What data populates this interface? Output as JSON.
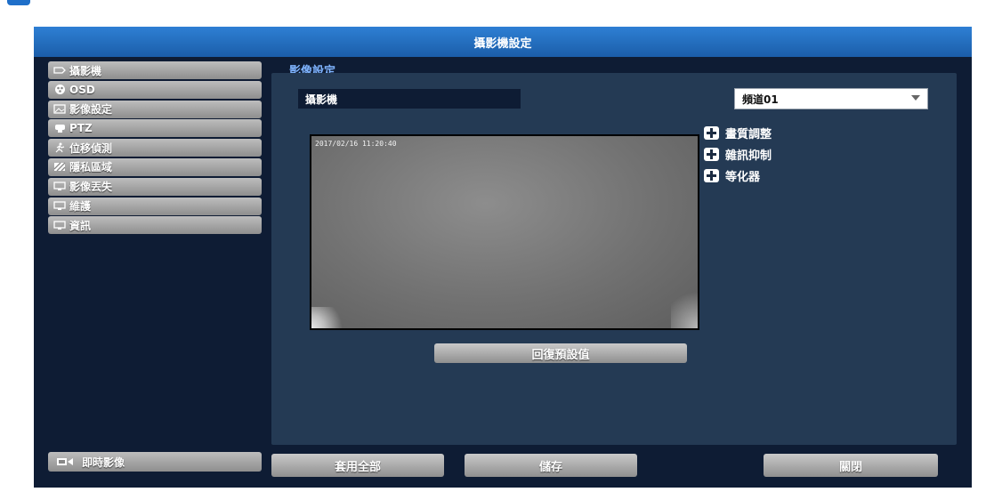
{
  "window": {
    "title": "攝影機設定"
  },
  "sidebar": {
    "items": [
      {
        "label": "攝影機",
        "icon": "camera-icon"
      },
      {
        "label": "OSD",
        "icon": "osd-icon"
      },
      {
        "label": "影像設定",
        "icon": "image-icon"
      },
      {
        "label": "PTZ",
        "icon": "ptz-icon"
      },
      {
        "label": "位移偵測",
        "icon": "motion-icon"
      },
      {
        "label": "隱私區域",
        "icon": "privacy-icon"
      },
      {
        "label": "影像丟失",
        "icon": "monitor-icon"
      },
      {
        "label": "維護",
        "icon": "monitor-icon"
      },
      {
        "label": "資訊",
        "icon": "monitor-icon"
      }
    ],
    "live_button": "即時影像"
  },
  "main": {
    "section_tab": "影像設定",
    "camera_label": "攝影機",
    "channel_select": {
      "value": "頻道01"
    },
    "video": {
      "timestamp": "2017/02/16 11:20:40"
    },
    "options": [
      {
        "label": "畫質調整"
      },
      {
        "label": "雜訊抑制"
      },
      {
        "label": "等化器"
      }
    ],
    "restore_button": "回復預設值"
  },
  "footer": {
    "apply_all": "套用全部",
    "save": "儲存",
    "close": "關閉"
  },
  "colors": {
    "title_bar": "#2e7fd4",
    "background": "#0e1c34",
    "panel": "#243a54",
    "button": "#a9a9a9"
  }
}
